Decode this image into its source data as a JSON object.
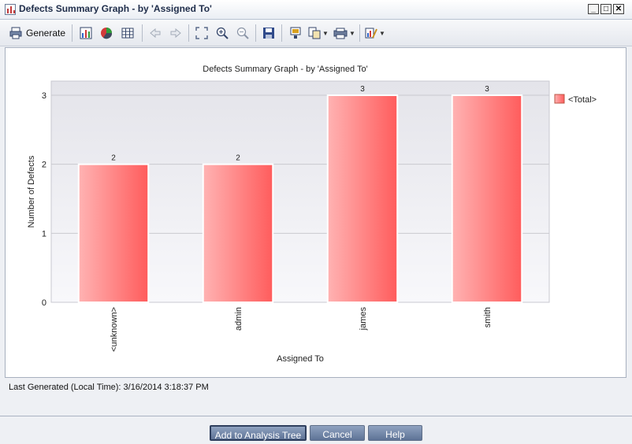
{
  "window": {
    "title": "Defects Summary Graph - by 'Assigned To'",
    "minimize_glyph": "_",
    "maximize_glyph": "□",
    "close_glyph": "✕"
  },
  "toolbar": {
    "generate_label": "Generate",
    "items": [
      "printer-icon",
      "bar-chart-icon",
      "pie-chart-icon",
      "grid-icon",
      "back-arrow-icon",
      "forward-arrow-icon",
      "fit-icon",
      "zoom-in-icon",
      "zoom-out-icon",
      "save-icon",
      "export-icon",
      "copy-icon",
      "print-icon",
      "graph-options-icon"
    ]
  },
  "chart_data": {
    "type": "bar",
    "title": "Defects Summary Graph - by 'Assigned To'",
    "xlabel": "Assigned To",
    "ylabel": "Number of Defects",
    "categories": [
      "<unknown>",
      "admin",
      "james",
      "smith"
    ],
    "series": [
      {
        "name": "<Total>",
        "values": [
          2,
          2,
          3,
          3
        ]
      }
    ],
    "ylim": [
      0,
      3
    ],
    "yticks": [
      0,
      1,
      2,
      3
    ],
    "grid": true,
    "legend": "right",
    "bar_color": "#ff5c5c",
    "bar_color_light": "#ffb3b3"
  },
  "status": {
    "last_generated": "Last Generated (Local Time): 3/16/2014 3:18:37 PM"
  },
  "buttons": {
    "add_to_analysis_tree": "Add to Analysis Tree",
    "cancel": "Cancel",
    "help": "Help"
  }
}
